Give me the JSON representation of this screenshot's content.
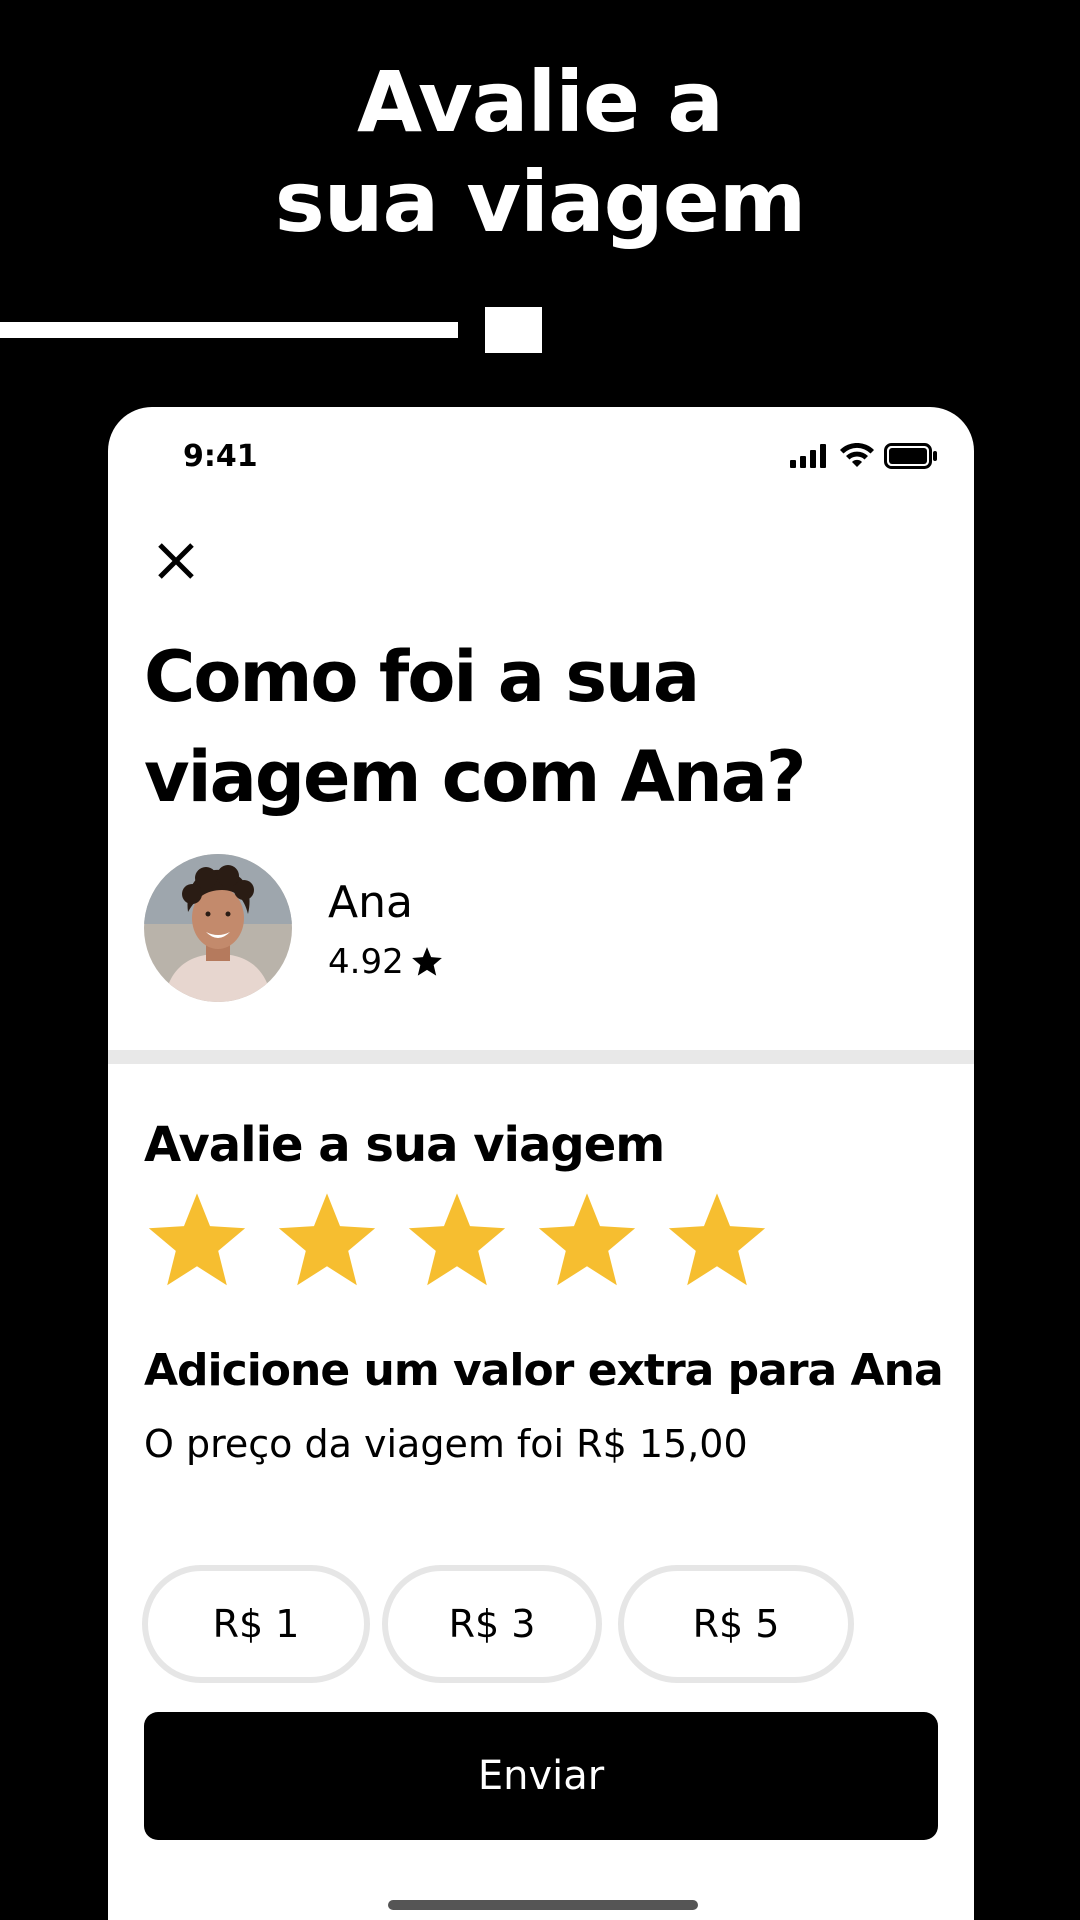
{
  "hero": {
    "title_line1": "Avalie a",
    "title_line2": "sua viagem"
  },
  "colors": {
    "background": "#000000",
    "card": "#ffffff",
    "star": "#f6be30",
    "chip_border": "#e6e6e6",
    "divider": "#e8e8e8"
  },
  "status_bar": {
    "time": "9:41",
    "icons": [
      "cellular-signal-icon",
      "wifi-icon",
      "battery-icon"
    ]
  },
  "header": {
    "close_icon": "close-icon",
    "question_line1": "Como foi a sua",
    "question_line2": "viagem com Ana?"
  },
  "driver": {
    "name": "Ana",
    "rating": "4.92",
    "rating_icon": "star-icon"
  },
  "rating_section": {
    "title": "Avalie a sua viagem",
    "stars_total": 5,
    "stars_selected": 5
  },
  "tip_section": {
    "title": "Adicione um valor extra para Ana",
    "subtitle": "O preço da viagem foi R$ 15,00",
    "options": [
      "R$ 1",
      "R$ 3",
      "R$ 5"
    ]
  },
  "actions": {
    "submit_label": "Enviar"
  }
}
